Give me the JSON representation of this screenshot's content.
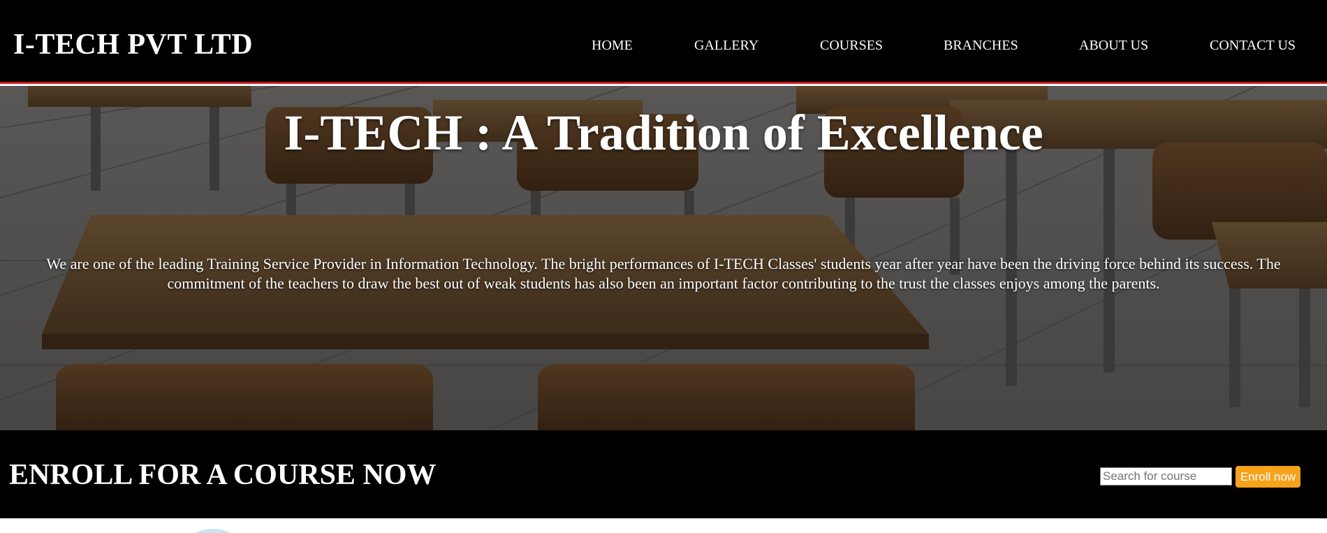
{
  "header": {
    "logo": "I-TECH PVT LTD",
    "nav": [
      {
        "label": "HOME"
      },
      {
        "label": "GALLERY"
      },
      {
        "label": "COURSES"
      },
      {
        "label": "BRANCHES"
      },
      {
        "label": "ABOUT US"
      },
      {
        "label": "CONTACT US"
      }
    ]
  },
  "hero": {
    "title": "I-TECH : A Tradition of Excellence",
    "description": "We are one of the leading Training Service Provider in Information Technology. The bright performances of I-TECH Classes' students year after year have been the driving force behind its success. The commitment of the teachers to draw the best out of weak students has also been an important factor contributing to the trust the classes enjoys among the parents."
  },
  "enroll": {
    "title": "ENROLL FOR A COURSE NOW",
    "search_placeholder": "Search for course",
    "search_value": "",
    "button_label": "Enroll now"
  },
  "colors": {
    "header_bg": "#000000",
    "header_border": "#c8161d",
    "button_accent": "#f7a21b",
    "text": "#ffffff"
  }
}
